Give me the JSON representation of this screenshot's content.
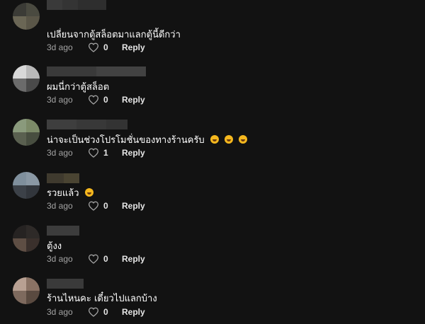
{
  "comments": [
    {
      "text": "เปลี่ยนจากตู้สล็อตมาแลกตู้นี้ดีกว่า",
      "time": "3d ago",
      "likes": "0",
      "reply": "Reply",
      "emoji_icons": [],
      "avatar_colors": [
        "#3b3b36",
        "#4a4a40",
        "#6a6655",
        "#5a5648"
      ]
    },
    {
      "text": "ผมนี่กว่าตู้สล็อต",
      "time": "3d ago",
      "likes": "0",
      "reply": "Reply",
      "emoji_icons": [],
      "avatar_colors": [
        "#d8d8d8",
        "#b9b9b9",
        "#6b6b6b",
        "#4a4a4a"
      ]
    },
    {
      "text": "น่าจะเป็นช่วงโปรโมชั่นของทางร้านครับ",
      "time": "3d ago",
      "likes": "1",
      "reply": "Reply",
      "emoji_icons": [
        "face-with-tears-of-joy-icon",
        "face-with-tears-of-joy-icon",
        "face-with-tears-of-joy-icon"
      ],
      "avatar_colors": [
        "#8a9a7c",
        "#7c8a68",
        "#5a6050",
        "#484e40"
      ]
    },
    {
      "text": "รวยแล้ว",
      "time": "3d ago",
      "likes": "0",
      "reply": "Reply",
      "emoji_icons": [
        "rolling-on-the-floor-laughing-icon"
      ],
      "avatar_colors": [
        "#7f8f9c",
        "#8a98a4",
        "#3c4148",
        "#32363c"
      ]
    },
    {
      "text": "ตู้งง",
      "time": "3d ago",
      "likes": "0",
      "reply": "Reply",
      "emoji_icons": [],
      "avatar_colors": [
        "#262322",
        "#2e2a28",
        "#5e4e44",
        "#3a302c"
      ]
    },
    {
      "text": "ร้านไหนคะ เดี๋ยวไปแลกบ้าง",
      "time": "3d ago",
      "likes": "0",
      "reply": "Reply",
      "emoji_icons": [],
      "avatar_colors": [
        "#b8a092",
        "#8a7264",
        "#7e6a5e",
        "#5a4a40"
      ]
    }
  ]
}
